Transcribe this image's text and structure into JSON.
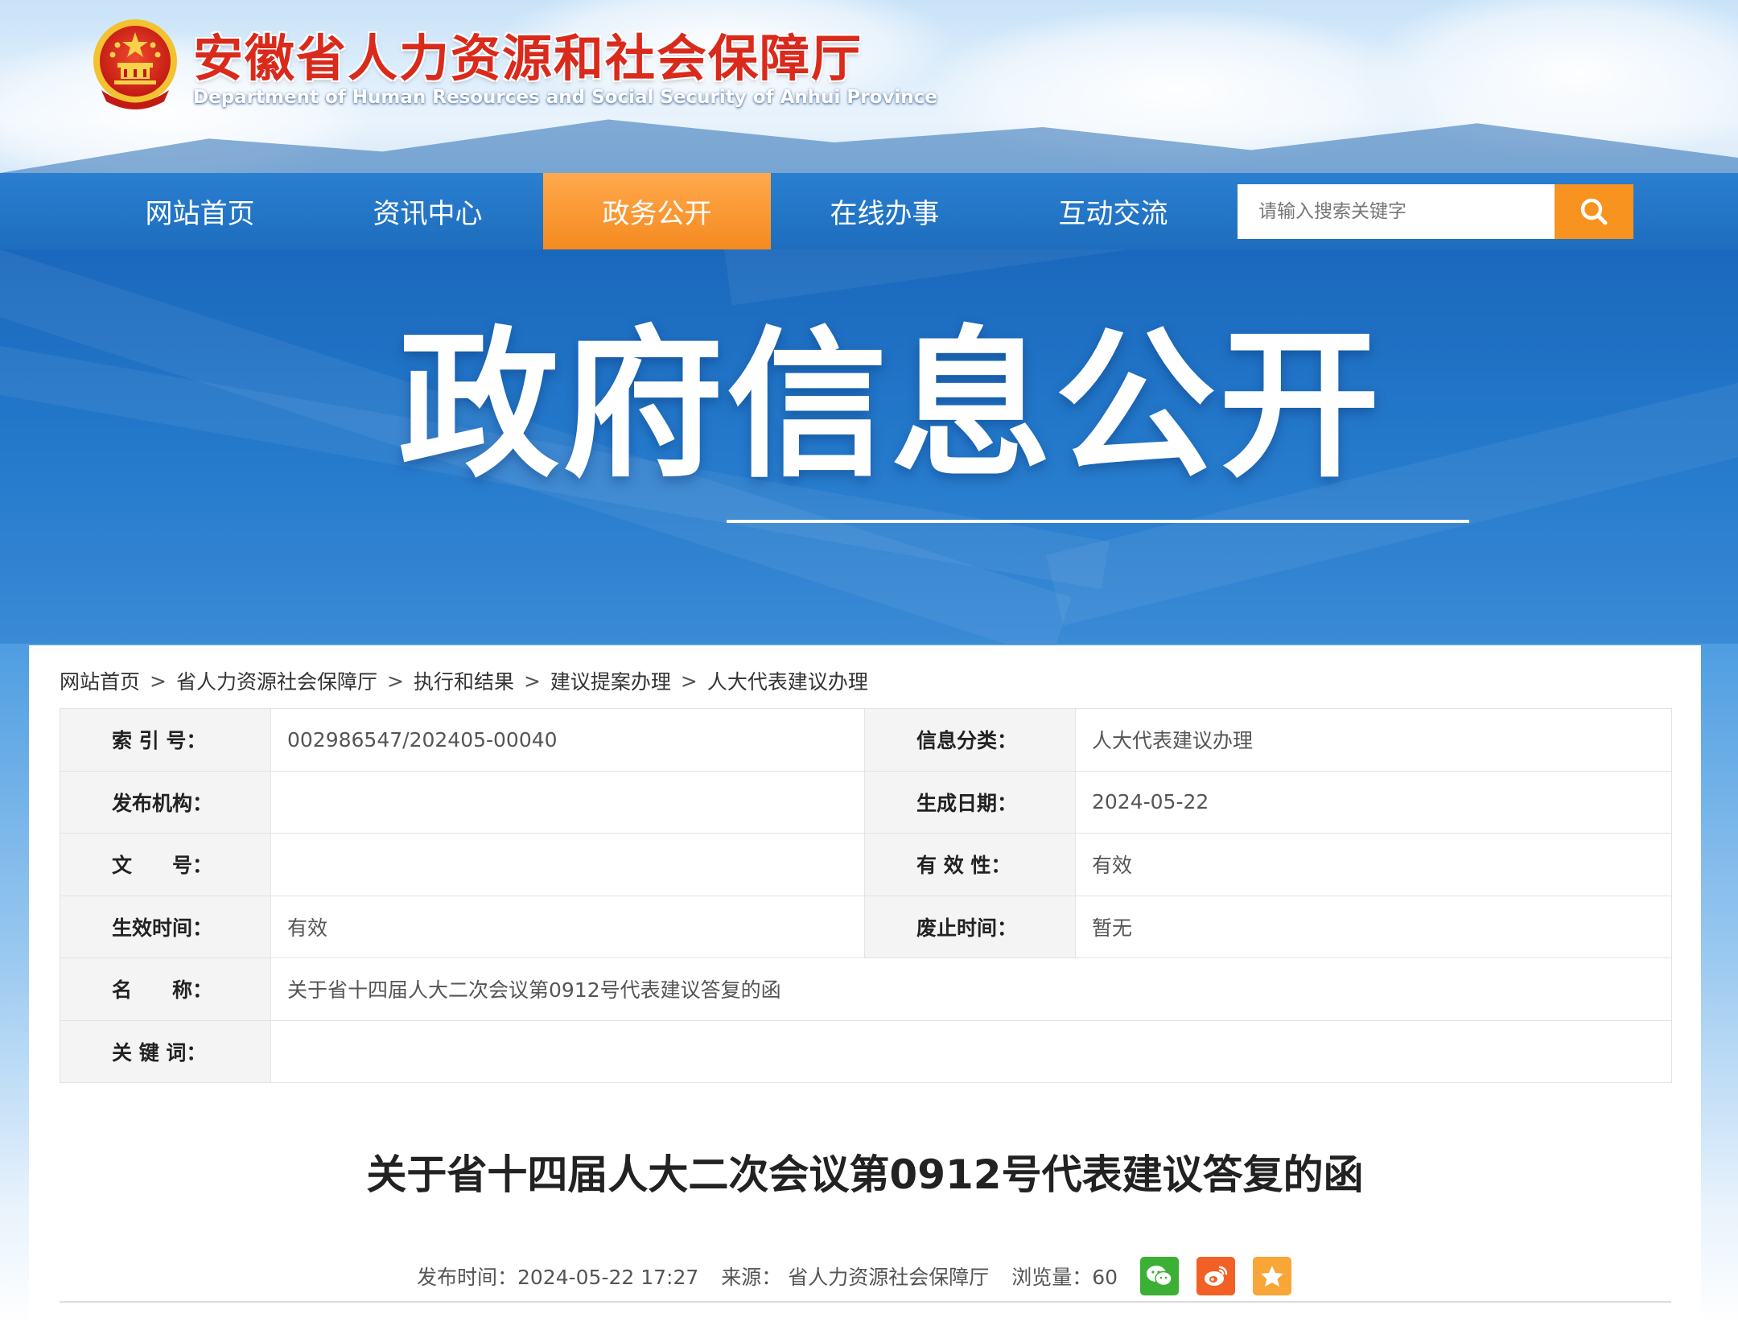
{
  "header": {
    "title": "安徽省人力资源和社会保障厅",
    "subtitle": "Department of Human Resources and Social Security of Anhui Province"
  },
  "nav": {
    "items": [
      {
        "label": "网站首页",
        "active": false
      },
      {
        "label": "资讯中心",
        "active": false
      },
      {
        "label": "政务公开",
        "active": true
      },
      {
        "label": "在线办事",
        "active": false
      },
      {
        "label": "互动交流",
        "active": false
      }
    ],
    "search_placeholder": "请输入搜索关键字"
  },
  "banner": {
    "title": "政府信息公开"
  },
  "breadcrumb": {
    "items": [
      "网站首页",
      "省人力资源社会保障厅",
      "执行和结果",
      "建议提案办理",
      "人大代表建议办理"
    ],
    "separator": ">"
  },
  "meta": {
    "index_no_label": "索 引 号：",
    "index_no": "002986547/202405-00040",
    "category_label": "信息分类：",
    "category": "人大代表建议办理",
    "publisher_label": "发布机构：",
    "publisher": "",
    "created_label": "生成日期：",
    "created": "2024-05-22",
    "doc_no_label": "文　　号：",
    "doc_no": "",
    "validity_label": "有 效 性：",
    "validity": "有效",
    "effective_label": "生效时间：",
    "effective": "有效",
    "repeal_label": "废止时间：",
    "repeal": "暂无",
    "name_label": "名　　称：",
    "name": "关于省十四届人大二次会议第0912号代表建议答复的函",
    "keywords_label": "关 键 词：",
    "keywords": ""
  },
  "document": {
    "title": "关于省十四届人大二次会议第0912号代表建议答复的函",
    "publish_time": "发布时间：2024-05-22 17:27",
    "source": "来源： 省人力资源社会保障厅",
    "views": "浏览量：60"
  },
  "colors": {
    "nav_bg": "#1e6dbe",
    "nav_active": "#f58a1f",
    "title_red": "#d92a1c",
    "wechat": "#3cb034",
    "weibo": "#f16024",
    "favorite": "#f8a637"
  },
  "icons": {
    "emblem": "national-emblem-icon",
    "search": "search-icon",
    "share": [
      "wechat-icon",
      "weibo-icon",
      "favorite-star-icon"
    ]
  }
}
